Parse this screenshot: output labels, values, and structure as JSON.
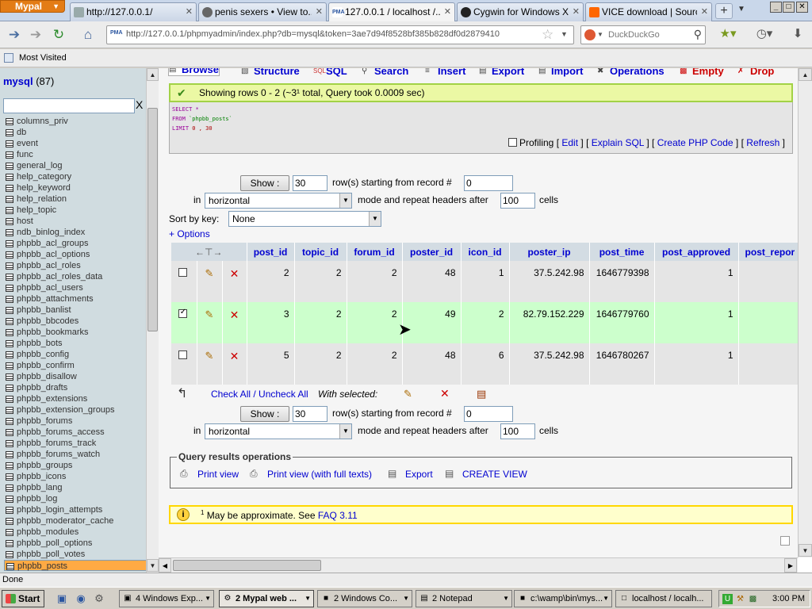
{
  "browser": {
    "app_menu": "Mypal",
    "tabs": [
      {
        "title": "http://127.0.0.1/",
        "icon": "page-icon"
      },
      {
        "title": "penis sexers • View to...",
        "icon": "forum-icon"
      },
      {
        "title": "127.0.0.1 / localhost /...",
        "icon": "pma-icon",
        "active": true
      },
      {
        "title": "Cygwin for Windows X...",
        "icon": "cygwin-icon"
      },
      {
        "title": "VICE download | Sourc...",
        "icon": "sourceforge-icon"
      }
    ],
    "new_tab": "+",
    "url": "http://127.0.0.1/phpmyadmin/index.php?db=mysql&token=3ae7d94f8528bf385b828df0d2879410",
    "search_placeholder": "DuckDuckGo",
    "bookmarks": {
      "most_visited": "Most Visited"
    },
    "status": "Done"
  },
  "sidebar": {
    "db_name": "mysql",
    "db_count": "(87)",
    "filter_clear": "X",
    "tables": [
      "columns_priv",
      "db",
      "event",
      "func",
      "general_log",
      "help_category",
      "help_keyword",
      "help_relation",
      "help_topic",
      "host",
      "ndb_binlog_index",
      "phpbb_acl_groups",
      "phpbb_acl_options",
      "phpbb_acl_roles",
      "phpbb_acl_roles_data",
      "phpbb_acl_users",
      "phpbb_attachments",
      "phpbb_banlist",
      "phpbb_bbcodes",
      "phpbb_bookmarks",
      "phpbb_bots",
      "phpbb_config",
      "phpbb_confirm",
      "phpbb_disallow",
      "phpbb_drafts",
      "phpbb_extensions",
      "phpbb_extension_groups",
      "phpbb_forums",
      "phpbb_forums_access",
      "phpbb_forums_track",
      "phpbb_forums_watch",
      "phpbb_groups",
      "phpbb_icons",
      "phpbb_lang",
      "phpbb_log",
      "phpbb_login_attempts",
      "phpbb_moderator_cache",
      "phpbb_modules",
      "phpbb_poll_options",
      "phpbb_poll_votes",
      "phpbb_posts"
    ],
    "selected_table": "phpbb_posts"
  },
  "main": {
    "tabs": {
      "browse": "Browse",
      "structure": "Structure",
      "sql": "SQL",
      "search": "Search",
      "insert": "Insert",
      "export": "Export",
      "import": "Import",
      "operations": "Operations",
      "empty": "Empty",
      "drop": "Drop"
    },
    "success_message": "Showing rows 0 - 2 (~3¹ total, Query took 0.0009 sec)",
    "sql": {
      "line1_kw": "SELECT",
      "line1_rest": " *",
      "line2_kw": "FROM",
      "line2_tbl": " `phpbb_posts`",
      "line3_kw": "LIMIT",
      "line3_num": " 0 , 30"
    },
    "profiling": {
      "label": "Profiling",
      "lb1": "[",
      "edit": "Edit",
      "sep1": "] [",
      "explain": "Explain SQL",
      "sep2": "] [",
      "php": "Create PHP Code",
      "sep3": "] [",
      "refresh": "Refresh",
      "rb": "]"
    },
    "nav_top": {
      "show_button": "Show :",
      "rows": "30",
      "rows_label": "row(s) starting from record #",
      "start": "0",
      "in": "in",
      "mode": "horizontal",
      "mode_label": "mode and repeat headers after",
      "repeat": "100",
      "cells": "cells"
    },
    "sort": {
      "label": "Sort by key:",
      "value": "None"
    },
    "options_link": "+ Options",
    "columns": [
      "post_id",
      "topic_id",
      "forum_id",
      "poster_id",
      "icon_id",
      "poster_ip",
      "post_time",
      "post_approved",
      "post_repor"
    ],
    "rows": [
      {
        "checked": false,
        "values": [
          "2",
          "2",
          "2",
          "48",
          "1",
          "37.5.242.98",
          "1646779398",
          "1"
        ]
      },
      {
        "checked": true,
        "values": [
          "3",
          "2",
          "2",
          "49",
          "2",
          "82.79.152.229",
          "1646779760",
          "1"
        ]
      },
      {
        "checked": false,
        "values": [
          "5",
          "2",
          "2",
          "48",
          "6",
          "37.5.242.98",
          "1646780267",
          "1"
        ]
      }
    ],
    "with_selected": {
      "check_all": "Check All / Uncheck All",
      "label": "With selected:"
    },
    "nav_bottom": {
      "show_button": "Show :",
      "rows": "30",
      "rows_label": "row(s) starting from record #",
      "start": "0",
      "in": "in",
      "mode": "horizontal",
      "mode_label": "mode and repeat headers after",
      "repeat": "100",
      "cells": "cells"
    },
    "query_ops": {
      "legend": "Query results operations",
      "print_view": "Print view",
      "print_full": "Print view (with full texts)",
      "export": "Export",
      "create_view": "CREATE VIEW"
    },
    "notice": {
      "sup": "1",
      "text": " May be approximate. See ",
      "link": "FAQ 3.11"
    }
  },
  "taskbar": {
    "start": "Start",
    "tasks": [
      {
        "label": "4 Windows Exp...",
        "icon": "folder-icon"
      },
      {
        "label": "2 Mypal web ...",
        "icon": "browser-icon",
        "active": true
      },
      {
        "label": "2 Windows Co...",
        "icon": "console-icon"
      },
      {
        "label": "2 Notepad",
        "icon": "notepad-icon"
      },
      {
        "label": "c:\\wamp\\bin\\mys...",
        "icon": "console-icon"
      },
      {
        "label": "localhost / localh...",
        "icon": "window-icon"
      }
    ],
    "clock": "3:00 PM"
  }
}
